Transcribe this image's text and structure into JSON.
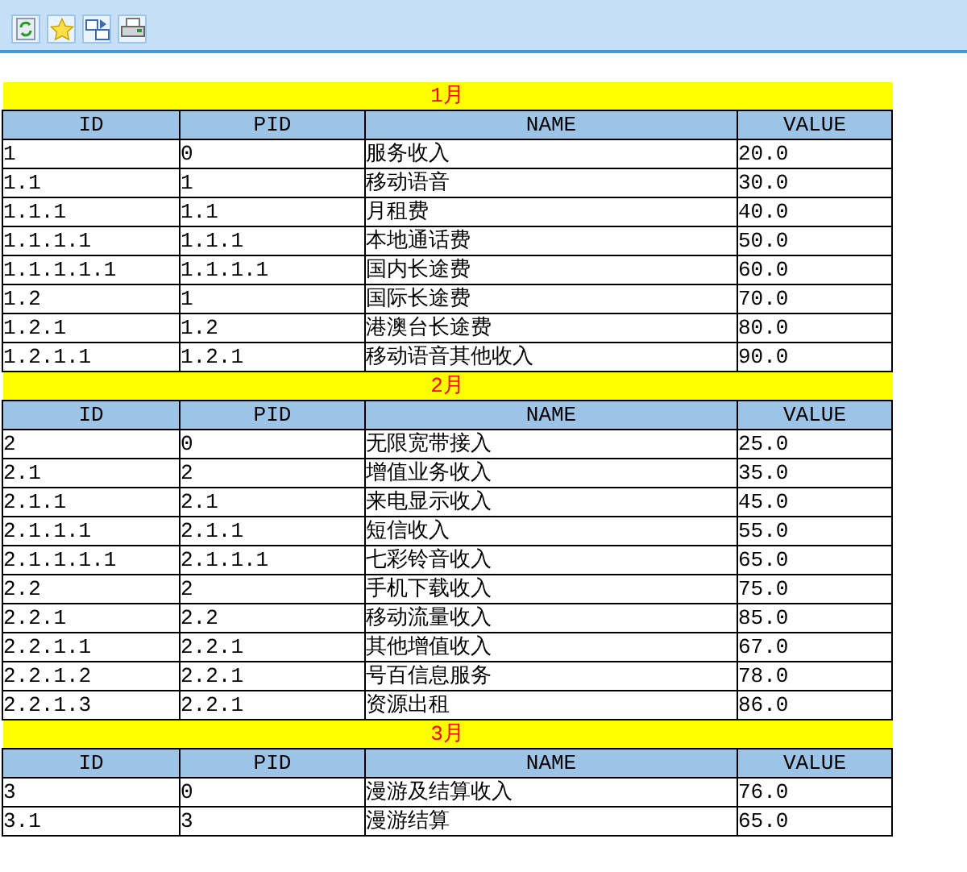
{
  "toolbar": {
    "buttons": [
      {
        "kind": "refresh"
      },
      {
        "kind": "star"
      },
      {
        "kind": "export"
      },
      {
        "kind": "print"
      }
    ]
  },
  "sections": [
    {
      "title": "1月",
      "columns": [
        "ID",
        "PID",
        "NAME",
        "VALUE"
      ],
      "rows": [
        [
          "1",
          "0",
          "服务收入",
          "20.0"
        ],
        [
          "1.1",
          "1",
          "移动语音",
          "30.0"
        ],
        [
          "1.1.1",
          "1.1",
          "月租费",
          "40.0"
        ],
        [
          "1.1.1.1",
          "1.1.1",
          "本地通话费",
          "50.0"
        ],
        [
          "1.1.1.1.1",
          "1.1.1.1",
          "国内长途费",
          "60.0"
        ],
        [
          "1.2",
          "1",
          "国际长途费",
          "70.0"
        ],
        [
          "1.2.1",
          "1.2",
          "港澳台长途费",
          "80.0"
        ],
        [
          "1.2.1.1",
          "1.2.1",
          "移动语音其他收入",
          "90.0"
        ]
      ]
    },
    {
      "title": "2月",
      "columns": [
        "ID",
        "PID",
        "NAME",
        "VALUE"
      ],
      "rows": [
        [
          "2",
          "0",
          "无限宽带接入",
          "25.0"
        ],
        [
          "2.1",
          "2",
          "增值业务收入",
          "35.0"
        ],
        [
          "2.1.1",
          "2.1",
          "来电显示收入",
          "45.0"
        ],
        [
          "2.1.1.1",
          "2.1.1",
          "短信收入",
          "55.0"
        ],
        [
          "2.1.1.1.1",
          "2.1.1.1",
          "七彩铃音收入",
          "65.0"
        ],
        [
          "2.2",
          "2",
          "手机下载收入",
          "75.0"
        ],
        [
          "2.2.1",
          "2.2",
          "移动流量收入",
          "85.0"
        ],
        [
          "2.2.1.1",
          "2.2.1",
          "其他增值收入",
          "67.0"
        ],
        [
          "2.2.1.2",
          "2.2.1",
          "号百信息服务",
          "78.0"
        ],
        [
          "2.2.1.3",
          "2.2.1",
          "资源出租",
          "86.0"
        ]
      ]
    },
    {
      "title": "3月",
      "columns": [
        "ID",
        "PID",
        "NAME",
        "VALUE"
      ],
      "rows": [
        [
          "3",
          "0",
          "漫游及结算收入",
          "76.0"
        ],
        [
          "3.1",
          "3",
          "漫游结算",
          "65.0"
        ]
      ]
    }
  ]
}
